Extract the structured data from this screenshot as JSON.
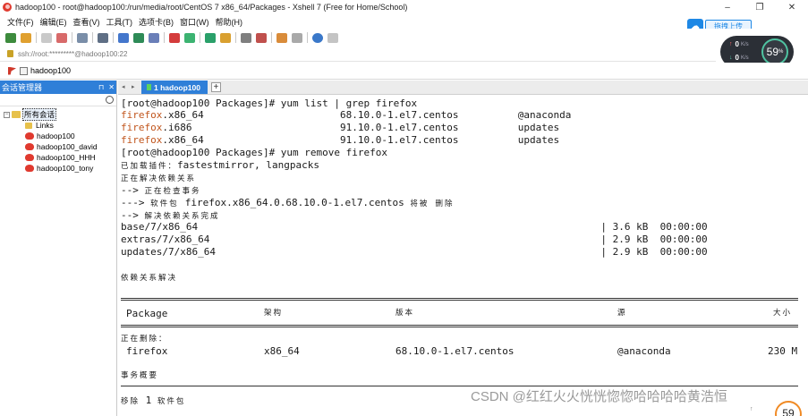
{
  "window": {
    "title": "hadoop100 - root@hadoop100:/run/media/root/CentOS 7 x86_64/Packages - Xshell 7 (Free for Home/School)",
    "controls": [
      "–",
      "❐",
      "✕"
    ]
  },
  "menu": [
    "文件(F)",
    "编辑(E)",
    "查看(V)",
    "工具(T)",
    "选项卡(B)",
    "窗口(W)",
    "帮助(H)"
  ],
  "upload": {
    "label": "拖拽上传"
  },
  "network": {
    "up": "0",
    "down": "0",
    "unit": "K/s",
    "percent": "59",
    "percent_sign": "%"
  },
  "address": "ssh://root:*********@hadoop100:22",
  "session_bar": {
    "label": "hadoop100"
  },
  "session_manager": {
    "title": "会话管理器",
    "pin": "⊓",
    "close": "✕",
    "root": "所有会话",
    "items": [
      "Links",
      "hadoop100",
      "hadoop100_david",
      "hadoop100_HHH",
      "hadoop100_tony"
    ]
  },
  "tab": {
    "label": "1 hadoop100",
    "add": "+"
  },
  "terminal": {
    "l1": "[root@hadoop100 Packages]# yum list | grep firefox",
    "l2_hl": "firefox",
    "l2_rest": ".x86_64                       68.10.0-1.el7.centos          @anaconda",
    "l3_hl": "firefox",
    "l3_rest": ".i686                         91.10.0-1.el7.centos          updates",
    "l4_hl": "firefox",
    "l4_rest": ".x86_64                       91.10.0-1.el7.centos          updates",
    "l5": "[root@hadoop100 Packages]# yum remove firefox",
    "l6_cn": "已加载插件：",
    "l6_rest": "fastestmirror, langpacks",
    "l7_cn": "正在解决依赖关系",
    "l8_pre": "--> ",
    "l8_cn": "正在检查事务",
    "l9_pre": "---> ",
    "l9_cn": "软件包 ",
    "l9_mid": "firefox.x86_64.0.68.10.0-1.el7.centos ",
    "l9_cn2": "将被 删除",
    "l10_pre": "--> ",
    "l10_cn": "解决依赖关系完成",
    "l11": "base/7/x86_64                                                                    | 3.6 kB  00:00:00",
    "l12": "extras/7/x86_64                                                                  | 2.9 kB  00:00:00",
    "l13": "updates/7/x86_64                                                                 | 2.9 kB  00:00:00",
    "l14_cn": "依赖关系解决",
    "col_package": "Package",
    "col_arch": "架构",
    "col_version": "版本",
    "col_repo": "源",
    "col_size": "大小",
    "removing_cn": "正在删除：",
    "row_name": "firefox",
    "row_arch": "x86_64",
    "row_version": "68.10.0-1.el7.centos",
    "row_repo": "@anaconda",
    "row_size": "230 M",
    "summary_cn": "事务概要",
    "remove_cn": "移除",
    "remove_count": "1",
    "remove_unit_cn": "软件包"
  },
  "watermark": "CSDN @红红火火恍恍惚惚哈哈哈哈黄浩恒",
  "corner_gauge": "59"
}
